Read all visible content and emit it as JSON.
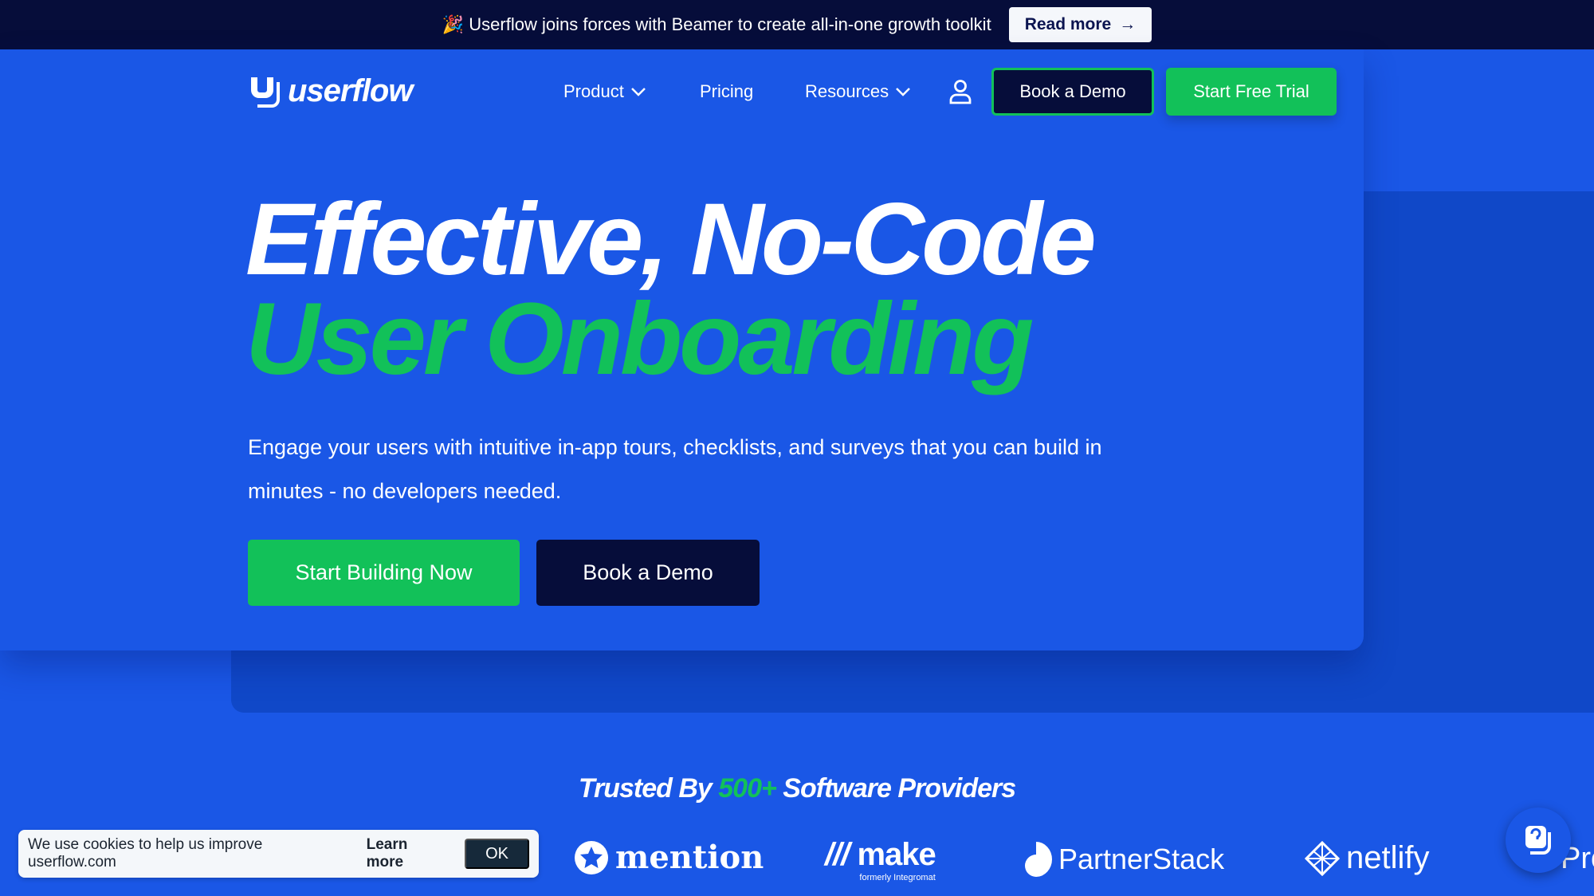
{
  "announcement": {
    "emoji": "🎉",
    "text": "Userflow joins forces with Beamer to create all-in-one growth toolkit",
    "button": "Read more",
    "button_icon": "arrow-right-icon"
  },
  "header": {
    "logo": "userflow",
    "nav": [
      {
        "label": "Product",
        "dropdown": true
      },
      {
        "label": "Pricing",
        "dropdown": false
      },
      {
        "label": "Resources",
        "dropdown": true
      }
    ],
    "account_icon": "user-icon",
    "book_demo": "Book a Demo",
    "start_trial": "Start Free Trial"
  },
  "hero": {
    "title_line1": "Effective, No-Code",
    "title_line2": "User Onboarding",
    "subtitle": "Engage your users with intuitive in-app tours, checklists, and surveys that you can build in minutes - no developers needed.",
    "cta_primary": "Start Building Now",
    "cta_secondary": "Book a Demo"
  },
  "trusted": {
    "prefix": "Trusted By",
    "highlight": "500+",
    "suffix": "Software Providers"
  },
  "logos": [
    {
      "name": "mention"
    },
    {
      "name": "make",
      "tagline": "formerly Integromat"
    },
    {
      "name": "PartnerStack"
    },
    {
      "name": "netlify"
    },
    {
      "name": "Pro"
    }
  ],
  "cookie": {
    "text": "We use cookies to help us improve userflow.com",
    "learn_more": "Learn more",
    "ok": "OK"
  },
  "colors": {
    "brand_blue": "#1a57e6",
    "dark_navy": "#060d3a",
    "green": "#12c159",
    "panel_blue": "#1048c8"
  }
}
